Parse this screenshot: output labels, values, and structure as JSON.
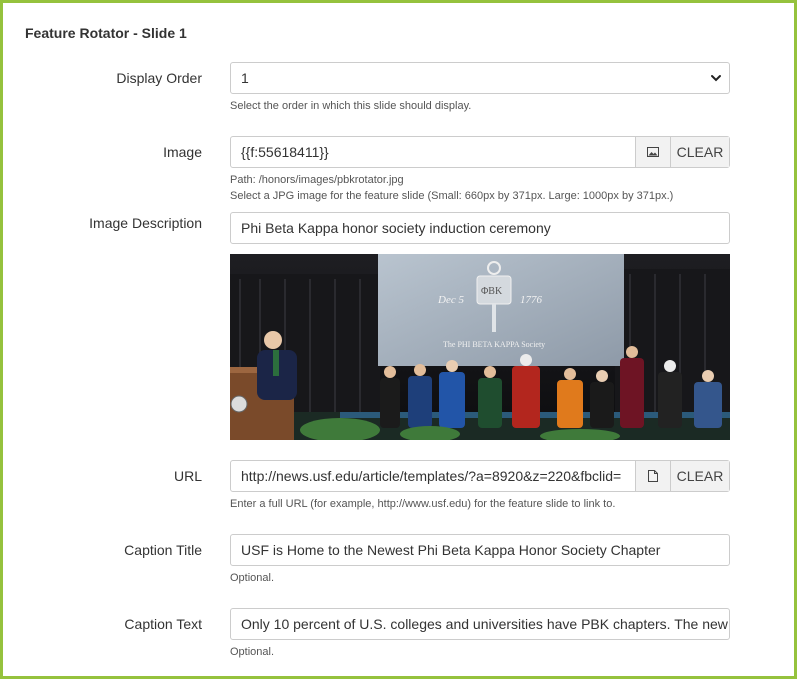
{
  "panel": {
    "title": "Feature Rotator - Slide 1"
  },
  "display_order": {
    "label": "Display Order",
    "selected": "1",
    "help": "Select the order in which this slide should display."
  },
  "image": {
    "label": "Image",
    "value": "{{f:55618411}}",
    "clear_label": "CLEAR",
    "path": "Path: /honors/images/pbkrotator.jpg",
    "help": "Select a JPG image for the feature slide (Small: 660px by 371px. Large: 1000px by 371px.)",
    "icon": "image-icon"
  },
  "image_description": {
    "label": "Image Description",
    "value": "Phi Beta Kappa honor society induction ceremony"
  },
  "photo_screen": {
    "date_left": "Dec 5",
    "key_text": "ΦΒΚ",
    "date_right": "1776",
    "society": "The PHI BETA KAPPA Society"
  },
  "url": {
    "label": "URL",
    "value": "http://news.usf.edu/article/templates/?a=8920&z=220&fbclid=",
    "clear_label": "CLEAR",
    "help": "Enter a full URL (for example, http://www.usf.edu) for the feature slide to link to.",
    "icon": "file-icon"
  },
  "caption_title": {
    "label": "Caption Title",
    "value": "USF is Home to the Newest Phi Beta Kappa Honor Society Chapter",
    "help": "Optional."
  },
  "caption_text": {
    "label": "Caption Text",
    "value": "Only 10 percent of U.S. colleges and universities have PBK chapters. The new",
    "help": "Optional."
  },
  "colors": {
    "frame_border": "#95c23d"
  }
}
